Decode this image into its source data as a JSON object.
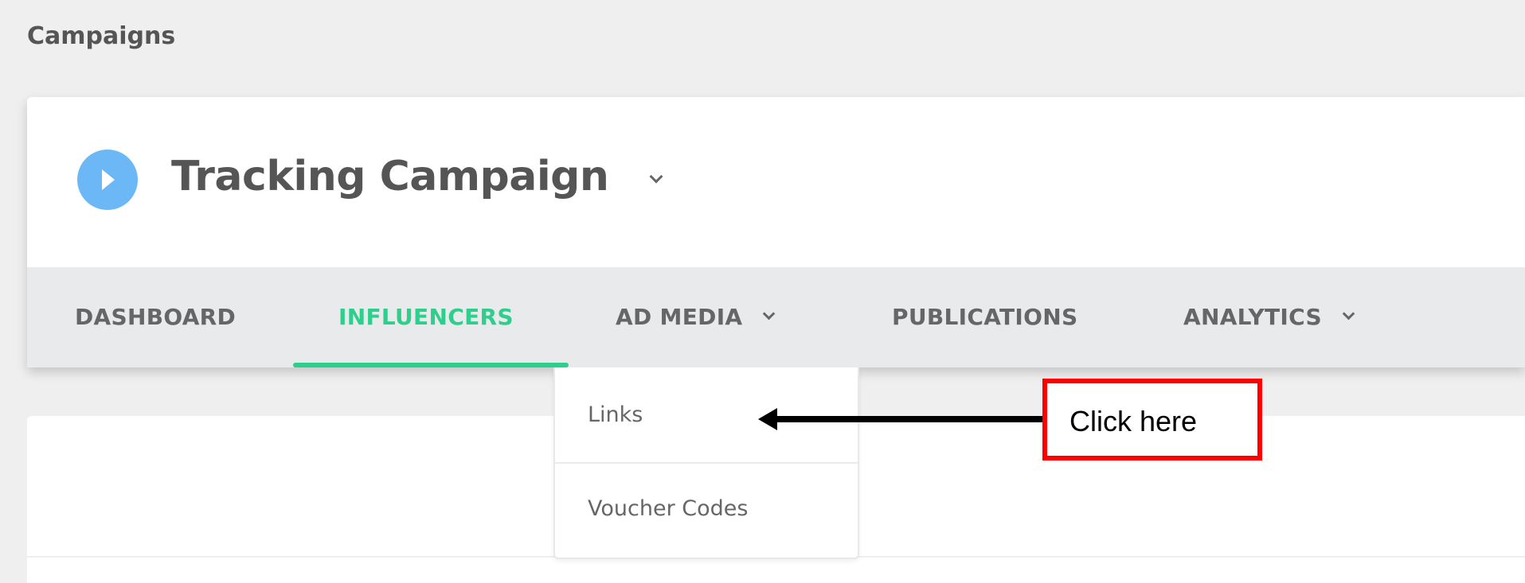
{
  "page_title": "Campaigns",
  "campaign": {
    "name": "Tracking Campaign",
    "status_icon": "play-circle-icon",
    "icon_color": "#6cb8f7"
  },
  "tabs": [
    {
      "label": "DASHBOARD",
      "active": false
    },
    {
      "label": "INFLUENCERS",
      "active": true
    },
    {
      "label": "AD MEDIA",
      "active": false,
      "has_dropdown": true
    },
    {
      "label": "PUBLICATIONS",
      "active": false
    },
    {
      "label": "ANALYTICS",
      "active": false,
      "has_dropdown": true
    }
  ],
  "accent_color": "#2ecf8d",
  "ad_media_menu": {
    "items": [
      {
        "label": "Links"
      },
      {
        "label": "Voucher Codes"
      }
    ]
  },
  "annotation": {
    "label": "Click here",
    "border_color": "#ff0000"
  }
}
